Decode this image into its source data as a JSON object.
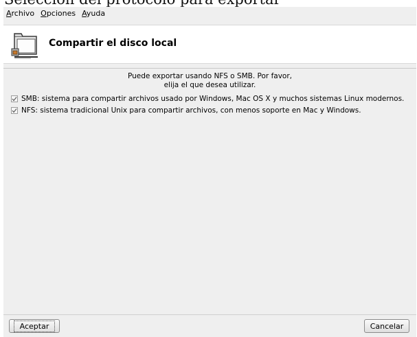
{
  "caption": "Selección del protocolo para exportar",
  "menu": [
    {
      "mnemonic": "A",
      "rest": "rchivo"
    },
    {
      "mnemonic": "O",
      "rest": "pciones"
    },
    {
      "mnemonic": "A",
      "rest": "yuda"
    }
  ],
  "header": {
    "title": "Compartir el disco local",
    "icon": "folder-share-icon"
  },
  "intro": {
    "line1": "Puede exportar usando NFS o SMB. Por favor,",
    "line2": "elija el que desea utilizar."
  },
  "options": [
    {
      "label": "SMB: sistema para compartir archivos usado por Windows, Mac OS X y muchos sistemas Linux modernos.",
      "checked": true
    },
    {
      "label": "NFS: sistema tradicional Unix para compartir archivos, con menos soporte en Mac y Windows.",
      "checked": true
    }
  ],
  "buttons": {
    "ok": "Aceptar",
    "cancel": "Cancelar"
  }
}
